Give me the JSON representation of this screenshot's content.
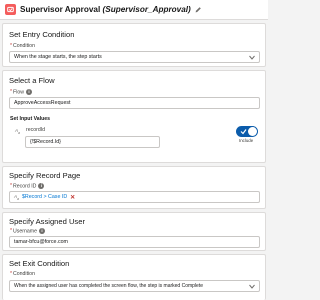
{
  "header": {
    "title": "Supervisor Approval",
    "api_name": "(Supervisor_Approval)",
    "icon_color": "#f45c5c"
  },
  "entry": {
    "title": "Set Entry Condition",
    "condition_label": "Condition",
    "condition_value": "When the stage starts, the step starts"
  },
  "flow": {
    "title": "Select a Flow",
    "flow_label": "Flow",
    "flow_value": "ApproveAccessRequest",
    "inputs_title": "Set Input Values",
    "input_name": "recordId",
    "input_value": "{!$Record.Id}",
    "include_label": "Include",
    "include_on": true
  },
  "record": {
    "title": "Specify Record Page",
    "record_label": "Record ID",
    "record_value": "$Record > Case ID"
  },
  "assigned": {
    "title": "Specify Assigned User",
    "username_label": "Username",
    "username_value": "tamar-bfcu@force.com"
  },
  "exit": {
    "title": "Set Exit Condition",
    "condition_label": "Condition",
    "condition_value": "When the assigned user has completed the screen flow, the step is marked Complete"
  },
  "colors": {
    "accent": "#0b5cab",
    "required": "#c23934",
    "link": "#0176d3"
  }
}
